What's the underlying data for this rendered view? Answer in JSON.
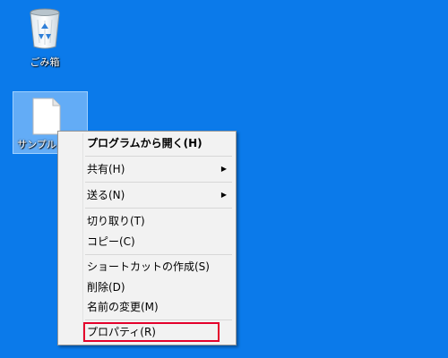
{
  "desktop": {
    "background_color": "#0b7aea",
    "icons": [
      {
        "name": "recycle-bin",
        "label": "ごみ箱",
        "icon": "recycle-bin-icon"
      },
      {
        "name": "sample-file",
        "label": "サンプル...",
        "icon": "document-icon",
        "selected": true
      }
    ]
  },
  "context_menu": {
    "items": [
      {
        "label": "プログラムから開く(H)",
        "bold": true
      },
      {
        "label": "共有(H)",
        "submenu": true
      },
      {
        "label": "送る(N)",
        "submenu": true
      },
      {
        "label": "切り取り(T)"
      },
      {
        "label": "コピー(C)"
      },
      {
        "label": "ショートカットの作成(S)"
      },
      {
        "label": "削除(D)"
      },
      {
        "label": "名前の変更(M)"
      },
      {
        "label": "プロパティ(R)",
        "highlighted": true
      }
    ],
    "highlight_color": "#e4002b"
  }
}
